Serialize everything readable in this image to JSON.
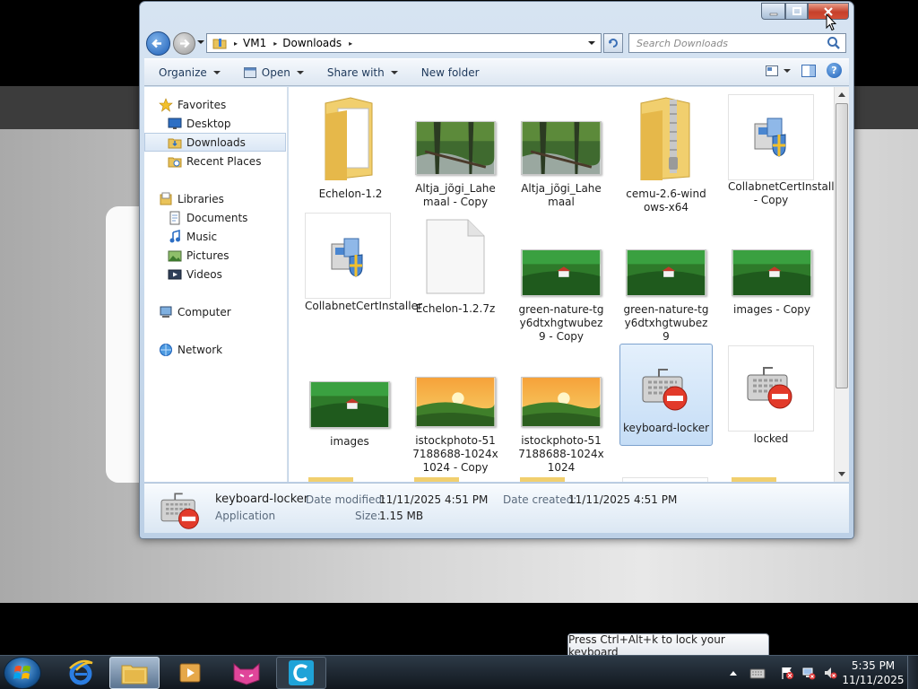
{
  "window": {
    "address": {
      "path": [
        "VM1",
        "Downloads"
      ],
      "separator": "▸"
    },
    "search": {
      "placeholder": "Search Downloads"
    },
    "toolbar": {
      "organize": "Organize",
      "open": "Open",
      "share_with": "Share with",
      "new_folder": "New folder"
    },
    "nav": {
      "favorites": "Favorites",
      "desktop": "Desktop",
      "downloads": "Downloads",
      "recent_places": "Recent Places",
      "libraries": "Libraries",
      "documents": "Documents",
      "music": "Music",
      "pictures": "Pictures",
      "videos": "Videos",
      "computer": "Computer",
      "network": "Network"
    },
    "files": [
      {
        "name": "Echelon-1.2",
        "kind": "folder"
      },
      {
        "name": "Altja_jõgi_Lahemaal - Copy",
        "kind": "photo-forest"
      },
      {
        "name": "Altja_jõgi_Lahemaal",
        "kind": "photo-forest"
      },
      {
        "name": "cemu-2.6-windows-x64",
        "kind": "zip-folder"
      },
      {
        "name": "CollabnetCertInstaller - Copy",
        "kind": "installer"
      },
      {
        "name": "CollabnetCertInstaller",
        "kind": "installer"
      },
      {
        "name": "Echelon-1.2.7z",
        "kind": "blank-file"
      },
      {
        "name": "green-nature-tgy6dtxhgtwubez9 - Copy",
        "kind": "photo-green"
      },
      {
        "name": "green-nature-tgy6dtxhgtwubez9",
        "kind": "photo-green"
      },
      {
        "name": "images - Copy",
        "kind": "photo-green"
      },
      {
        "name": "images",
        "kind": "photo-green"
      },
      {
        "name": "istockphoto-517188688-1024x1024 - Copy",
        "kind": "photo-sunset"
      },
      {
        "name": "istockphoto-517188688-1024x1024",
        "kind": "photo-sunset"
      },
      {
        "name": "keyboard-locker",
        "kind": "keyboard-app",
        "selected": true
      },
      {
        "name": "locked",
        "kind": "keyboard-app"
      }
    ],
    "details": {
      "name": "keyboard-locker",
      "type": "Application",
      "date_modified_label": "Date modified:",
      "date_modified": "11/11/2025 4:51 PM",
      "date_created_label": "Date created:",
      "date_created": "11/11/2025 4:51 PM",
      "size_label": "Size:",
      "size": "1.15 MB"
    }
  },
  "tooltip": "Press Ctrl+Alt+k to lock your keyboard",
  "taskbar": {
    "clock_time": "5:35 PM",
    "clock_date": "11/11/2025",
    "apps": [
      "internet-explorer",
      "file-explorer",
      "media-player",
      "cat-app",
      "c-app"
    ]
  },
  "colors": {
    "accent": "#1d5fb8",
    "close_red": "#c6402a",
    "selection": "#c5ddf6"
  }
}
